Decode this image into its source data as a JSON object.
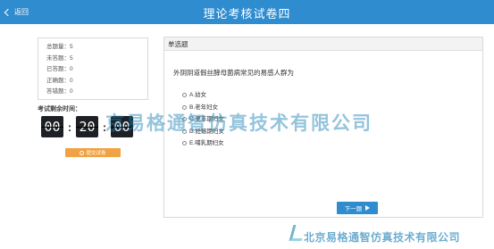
{
  "header": {
    "back_label": "返回",
    "title": "理论考核试卷四",
    "color": "#2e8ccf"
  },
  "stats": {
    "total": "总题量：5",
    "unanswered": "未答题：5",
    "answered": "已答题：0",
    "correct": "正确题：0",
    "wrong": "答错题：0"
  },
  "timer": {
    "label": "考试剩余时间：",
    "hours": "00",
    "minutes": "20",
    "seconds": "00"
  },
  "submit_label": "提交试卷",
  "question": {
    "type_label": "单选题",
    "text": "外阴阴道假丝酵母菌病常见的易感人群为",
    "options": [
      "A.幼女",
      "B.老年妇女",
      "C.更年期妇女",
      "D.妊娠期妇女",
      "E.哺乳期妇女"
    ]
  },
  "next_label": "下一题",
  "watermark": {
    "center": "京易格通智仿真技术有限公司",
    "bottom": "北京易格通智仿真技术有限公司"
  }
}
